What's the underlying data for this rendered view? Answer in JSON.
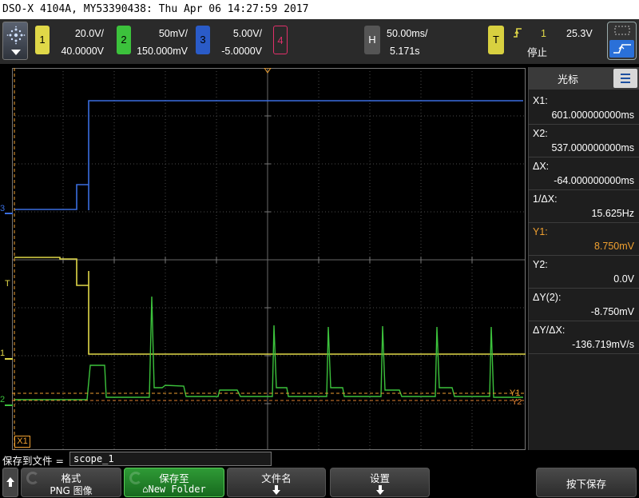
{
  "title": "DSO-X 4104A, MY53390438: Thu Apr 06 14:27:59 2017",
  "channels": [
    {
      "id": "1",
      "scale": "20.0V/",
      "offset": "40.0000V",
      "color": "#e0d848"
    },
    {
      "id": "2",
      "scale": "50mV/",
      "offset": "150.000mV",
      "color": "#3cc23c"
    },
    {
      "id": "3",
      "scale": "5.00V/",
      "offset": "-5.0000V",
      "color": "#3a6ee0"
    },
    {
      "id": "4",
      "scale": "",
      "offset": "",
      "color": "#e0306a"
    }
  ],
  "horizontal": {
    "badge": "H",
    "timebase": "50.00ms/",
    "position": "5.171s"
  },
  "trigger": {
    "badge": "T",
    "source": "1",
    "level": "25.3V",
    "status": "停止",
    "slope_icon": "rising-edge-icon"
  },
  "markers": {
    "ch3": "3",
    "ch1": "1",
    "ch2": "2",
    "trig": "T",
    "x1": "X1",
    "y1": "Y1",
    "y2": "Y2"
  },
  "cursors": {
    "title": "光标",
    "rows": [
      {
        "label": "X1:",
        "value": "601.000000000ms",
        "label_color": "#ffffff"
      },
      {
        "label": "X2:",
        "value": "537.000000000ms",
        "label_color": "#ffffff"
      },
      {
        "label": "ΔX:",
        "value": "-64.000000000ms",
        "label_color": "#ffffff"
      },
      {
        "label": "1/ΔX:",
        "value": "15.625Hz",
        "label_color": "#ffffff"
      },
      {
        "label": "Y1:",
        "value": "8.750mV",
        "label_color": "#f0a030"
      },
      {
        "label": "Y2:",
        "value": "0.0V",
        "label_color": "#ffffff"
      },
      {
        "label": "ΔY(2):",
        "value": "-8.750mV",
        "label_color": "#ffffff"
      },
      {
        "label": "ΔY/ΔX:",
        "value": "-136.719mV/s",
        "label_color": "#ffffff"
      }
    ]
  },
  "save": {
    "label": "保存到文件 =",
    "filename": "scope_1"
  },
  "softkeys": {
    "format_l1": "格式",
    "format_l2": "PNG 图像",
    "saveto_l1": "保存至",
    "saveto_l2": "⌂New Folder",
    "filename_l1": "文件名",
    "settings_l1": "设置",
    "press_save": "按下保存"
  },
  "colors": {
    "ch1": "#e0d848",
    "ch2": "#3cc23c",
    "ch3": "#3a6ee0",
    "ch4": "#e0306a",
    "cursor": "#f0a030"
  }
}
